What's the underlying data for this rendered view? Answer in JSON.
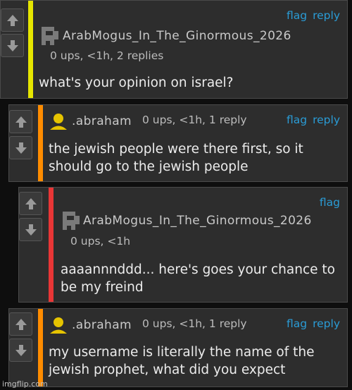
{
  "colors": {
    "stripe_level1": "#e6e600",
    "stripe_level2": "#ff8c00",
    "stripe_level3": "#e83636",
    "link": "#2a9cd6"
  },
  "comments": [
    {
      "username": "ArabMogus_In_The_Ginormous_2026",
      "avatar": "pixel-mogus-icon",
      "meta": "0 ups, <1h, 2 replies",
      "text": "what's your opinion on israel?",
      "flag": "flag",
      "reply": "reply"
    },
    {
      "username": ".abraham",
      "avatar": "user-silhouette-icon",
      "meta": "0 ups, <1h, 1 reply",
      "text": "the jewish people were there first, so it should go to the jewish people",
      "flag": "flag",
      "reply": "reply"
    },
    {
      "username": "ArabMogus_In_The_Ginormous_2026",
      "avatar": "pixel-mogus-icon",
      "meta": "0 ups, <1h",
      "text": "aaaannnddd... here's goes your chance to be my freind",
      "flag": "flag"
    },
    {
      "username": ".abraham",
      "avatar": "user-silhouette-icon",
      "meta": "0 ups, <1h, 1 reply",
      "text": "my username is literally the name of the jewish prophet, what did you expect",
      "flag": "flag",
      "reply": "reply"
    }
  ],
  "watermark": "imgflip.com"
}
